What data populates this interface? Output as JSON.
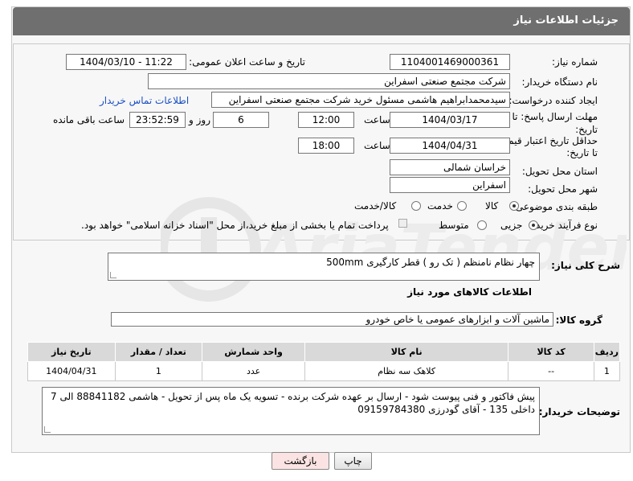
{
  "header": {
    "title": "جزئیات اطلاعات نیاز"
  },
  "form": {
    "need_number_label": "شماره نیاز:",
    "need_number": "1104001469000361",
    "announce_label": "تاریخ و ساعت اعلان عمومی:",
    "announce_value": "1404/03/10 - 11:22",
    "buyer_org_label": "نام دستگاه خریدار:",
    "buyer_org": "شرکت مجتمع صنعتی اسفراین",
    "creator_label": "ایجاد کننده درخواست:",
    "creator": "سیدمحمدابراهیم هاشمی مسئول خرید شرکت مجتمع صنعتی اسفراین",
    "contact_link": "اطلاعات تماس خریدار",
    "deadline_label_1": "مهلت ارسال پاسخ: تا",
    "deadline_label_2": "تاریخ:",
    "deadline_date": "1404/03/17",
    "time_label": "ساعت",
    "deadline_time": "12:00",
    "days_value": "6",
    "days_label": "روز و",
    "remaining_time": "23:52:59",
    "remaining_label": "ساعت باقی مانده",
    "validity_label_1": "حداقل تاریخ اعتبار قیمت:",
    "validity_label_2": "تا تاریخ:",
    "validity_date": "1404/04/31",
    "validity_time": "18:00",
    "province_label": "استان محل تحویل:",
    "province": "خراسان شمالی",
    "city_label": "شهر محل تحویل:",
    "city": "اسفراین",
    "category_label": "طبقه بندی موضوعی:",
    "category_options": [
      "کالا",
      "خدمت",
      "کالا/خدمت"
    ],
    "process_label": "نوع فرآیند خرید :",
    "process_options": [
      "جزیی",
      "متوسط"
    ],
    "payment_note": "پرداخت تمام یا بخشی از مبلغ خرید،از محل \"اسناد خزانه اسلامی\" خواهد بود."
  },
  "description": {
    "label": "شرح کلی نیاز:",
    "text": "چهار نظام نامنظم ( تک رو ) قطر کارگیری 500mm"
  },
  "goods_section": {
    "title": "اطلاعات کالاهای مورد نیاز",
    "group_label": "گروه کالا:",
    "group_value": "ماشین آلات و ابزارهای عمومی یا خاص خودرو",
    "columns": [
      "ردیف",
      "کد کالا",
      "نام کالا",
      "واحد شمارش",
      "تعداد / مقدار",
      "تاریخ نیاز"
    ],
    "rows": [
      {
        "row": "1",
        "code": "--",
        "name": "کلاهک سه نظام",
        "unit": "عدد",
        "qty": "1",
        "date": "1404/04/31"
      }
    ]
  },
  "buyer_notes": {
    "label": "توضیحات خریدار:",
    "text": "پیش فاکتور و فنی پیوست شود - ارسال بر عهده شرکت برنده - تسویه یک ماه پس از تحویل - هاشمی 88841182 الی 7 داخلی 135 - آقای گودرزی 09159784380"
  },
  "buttons": {
    "print": "چاپ",
    "back": "بازگشت"
  },
  "colors": {
    "header_bg": "#6f6f6f",
    "link": "#1a4fc4",
    "back_button_bg": "#fbe3e3"
  }
}
